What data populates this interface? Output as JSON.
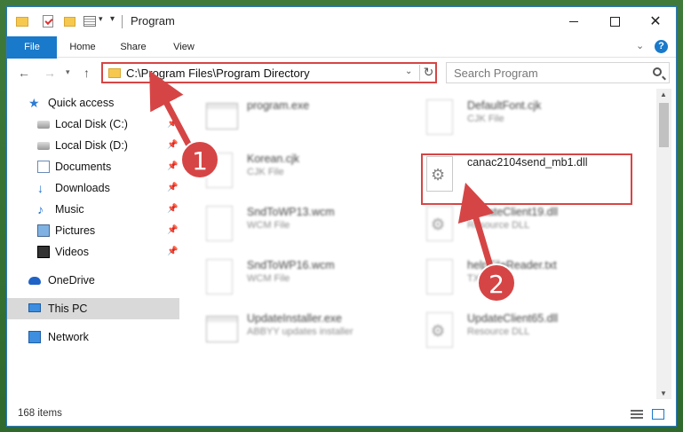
{
  "window": {
    "title": "Program",
    "controls": {
      "minimize": "minimize",
      "maximize": "maximize",
      "close": "✕"
    }
  },
  "ribbon": {
    "tabs": [
      "File",
      "Home",
      "Share",
      "View"
    ],
    "help": "?"
  },
  "nav": {
    "address": "C:\\Program Files\\Program Directory",
    "search_placeholder": "Search Program"
  },
  "sidebar": {
    "items": [
      {
        "label": "Quick access",
        "icon": "star-icon"
      },
      {
        "label": "Local Disk (C:)",
        "icon": "disk-icon",
        "pinned": true
      },
      {
        "label": "Local Disk (D:)",
        "icon": "disk-icon",
        "pinned": true
      },
      {
        "label": "Documents",
        "icon": "documents-icon",
        "pinned": true
      },
      {
        "label": "Downloads",
        "icon": "downloads-icon",
        "pinned": true
      },
      {
        "label": "Music",
        "icon": "music-icon",
        "pinned": true
      },
      {
        "label": "Pictures",
        "icon": "pictures-icon",
        "pinned": true
      },
      {
        "label": "Videos",
        "icon": "videos-icon",
        "pinned": true
      },
      {
        "label": "OneDrive",
        "icon": "onedrive-icon"
      },
      {
        "label": "This PC",
        "icon": "this-pc-icon",
        "selected": true
      },
      {
        "label": "Network",
        "icon": "network-icon"
      }
    ]
  },
  "files": [
    {
      "name": "program.exe",
      "type": "",
      "blurred": true
    },
    {
      "name": "DefaultFont.cjk",
      "type": "CJK File",
      "blurred": true
    },
    {
      "name": "Korean.cjk",
      "type": "CJK File",
      "blurred": true
    },
    {
      "name": "canac2104send_mb1.dll",
      "type": "",
      "blurred": false,
      "highlighted": true
    },
    {
      "name": "SndToWP13.wcm",
      "type": "WCM File",
      "blurred": true
    },
    {
      "name": "UpdateClient19.dll",
      "type": "Resource DLL",
      "blurred": true
    },
    {
      "name": "SndToWP16.wcm",
      "type": "WCM File",
      "blurred": true
    },
    {
      "name": "helpFileReader.txt",
      "type": "TXT",
      "blurred": true
    },
    {
      "name": "UpdateInstaller.exe",
      "type": "ABBYY updates installer",
      "blurred": true
    },
    {
      "name": "UpdateClient65.dll",
      "type": "Resource DLL",
      "blurred": true
    }
  ],
  "status": {
    "count": "168 items"
  },
  "annotations": {
    "badge1": "1",
    "badge2": "2"
  },
  "colors": {
    "accent": "#1979ca",
    "highlight": "#d64545"
  }
}
